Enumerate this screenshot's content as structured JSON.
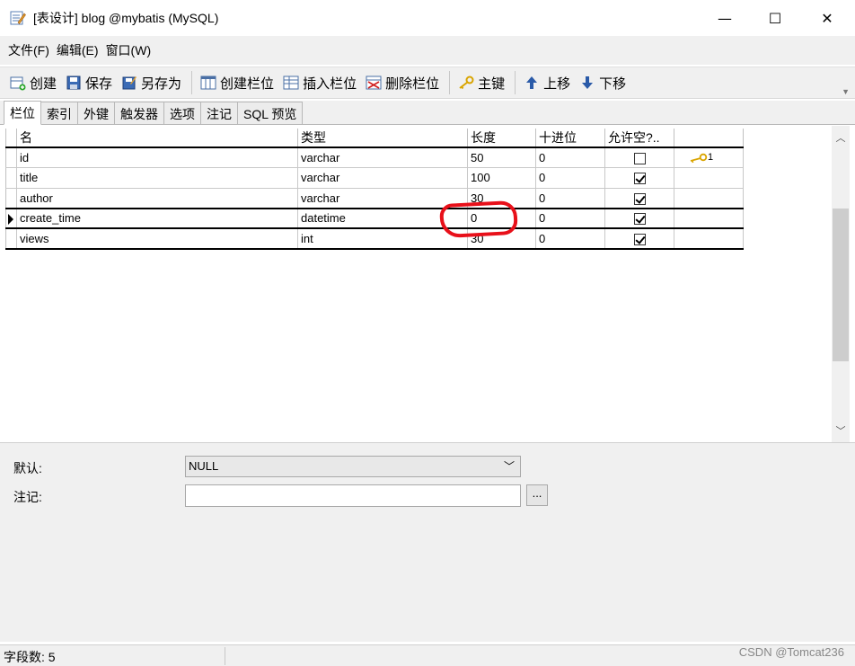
{
  "window": {
    "title": "[表设计] blog @mybatis (MySQL)",
    "min_glyph": "—",
    "max_glyph": "☐",
    "close_glyph": "✕"
  },
  "menu": [
    "文件(F)",
    "编辑(E)",
    "窗口(W)"
  ],
  "toolbar": {
    "create": "创建",
    "save": "保存",
    "save_as": "另存为",
    "create_column": "创建栏位",
    "insert_column": "插入栏位",
    "delete_column": "删除栏位",
    "primary_key": "主键",
    "move_up": "上移",
    "move_down": "下移"
  },
  "tabs": [
    "栏位",
    "索引",
    "外键",
    "触发器",
    "选项",
    "注记",
    "SQL 预览"
  ],
  "grid": {
    "headers": [
      "名",
      "类型",
      "长度",
      "十进位",
      "允许空?..",
      ""
    ],
    "rows": [
      {
        "name": "id",
        "type": "varchar",
        "length": "50",
        "decimal": "0",
        "nullable": false,
        "key": "1"
      },
      {
        "name": "title",
        "type": "varchar",
        "length": "100",
        "decimal": "0",
        "nullable": true,
        "key": ""
      },
      {
        "name": "author",
        "type": "varchar",
        "length": "30",
        "decimal": "0",
        "nullable": true,
        "key": ""
      },
      {
        "name": "create_time",
        "type": "datetime",
        "length": "0",
        "decimal": "0",
        "nullable": true,
        "key": ""
      },
      {
        "name": "views",
        "type": "int",
        "length": "30",
        "decimal": "0",
        "nullable": true,
        "key": ""
      }
    ]
  },
  "properties": {
    "default_label": "默认:",
    "default_value": "NULL",
    "comment_label": "注记:",
    "comment_value": "",
    "ellipsis": "..."
  },
  "status": {
    "field_count": "字段数: 5",
    "watermark": "CSDN @Tomcat236"
  },
  "colors": {
    "annotation": "#e8101a",
    "key_icon": "#d9a400"
  },
  "icons": {
    "app": "table-design-icon",
    "key": "key-icon"
  }
}
